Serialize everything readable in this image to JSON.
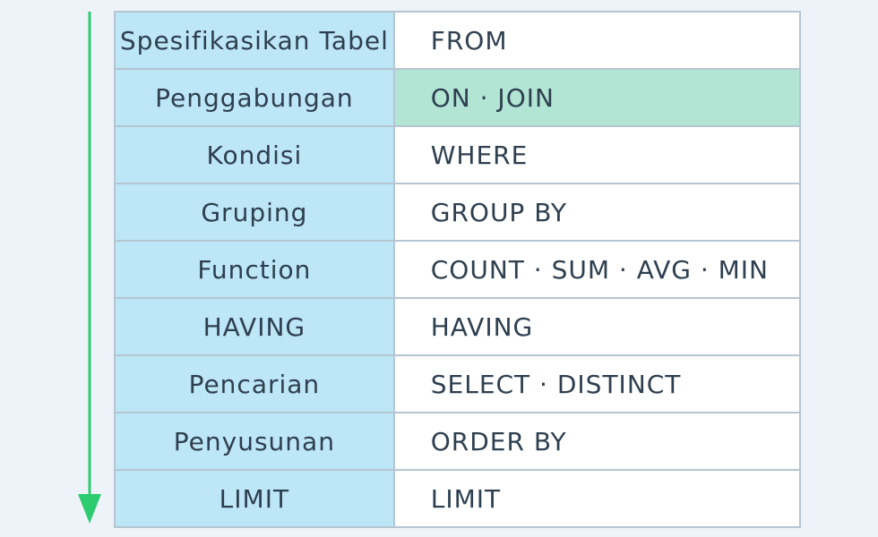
{
  "colors": {
    "background": "#eef3fa",
    "label_cell": "#bde6f6",
    "clause_cell": "#ffffff",
    "highlight_cell": "#b3e5d5",
    "border": "#b5c5d2",
    "arrow": "#2ecc71",
    "text": "#2e3f4f"
  },
  "flow_arrow": {
    "icon": "arrow-down-icon",
    "direction": "down"
  },
  "steps": [
    {
      "label": "Spesifikasikan Tabel",
      "clause": "FROM",
      "highlighted": false
    },
    {
      "label": "Penggabungan",
      "clause": "ON · JOIN",
      "highlighted": true
    },
    {
      "label": "Kondisi",
      "clause": "WHERE",
      "highlighted": false
    },
    {
      "label": "Gruping",
      "clause": "GROUP BY",
      "highlighted": false
    },
    {
      "label": "Function",
      "clause": "COUNT · SUM · AVG · MIN",
      "highlighted": false
    },
    {
      "label": "HAVING",
      "clause": "HAVING",
      "highlighted": false
    },
    {
      "label": "Pencarian",
      "clause": "SELECT · DISTINCT",
      "highlighted": false
    },
    {
      "label": "Penyusunan",
      "clause": "ORDER BY",
      "highlighted": false
    },
    {
      "label": "LIMIT",
      "clause": "LIMIT",
      "highlighted": false
    }
  ]
}
